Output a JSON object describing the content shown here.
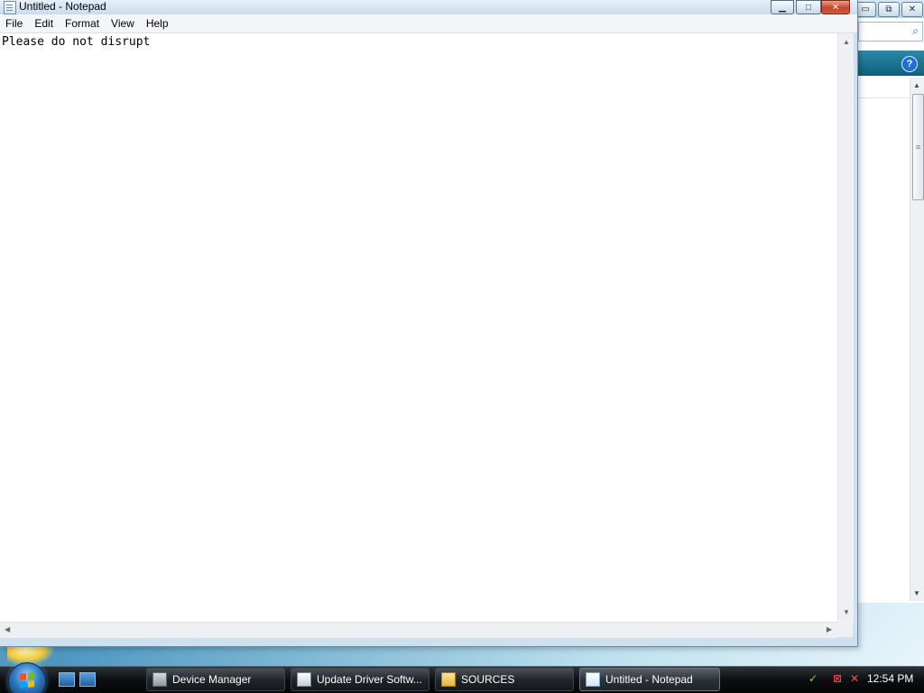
{
  "notepad": {
    "title": "Untitled - Notepad",
    "menu": [
      "File",
      "Edit",
      "Format",
      "View",
      "Help"
    ],
    "content": "Please do not disrupt"
  },
  "background_window": {
    "help_label": "?"
  },
  "taskbar": {
    "buttons": [
      {
        "label": "Device Manager",
        "icon": "device-manager-icon"
      },
      {
        "label": "Update Driver Softw...",
        "icon": "driver-icon"
      },
      {
        "label": "SOURCES",
        "icon": "folder-icon"
      },
      {
        "label": "Untitled - Notepad",
        "icon": "notepad-icon",
        "active": true
      }
    ],
    "clock": "12:54 PM"
  },
  "colors": {
    "taskbar": "#0b0d10",
    "titlebar": "#cfe0ee",
    "close_button": "#c7452c",
    "toolbar_teal": "#0f5f7a"
  }
}
